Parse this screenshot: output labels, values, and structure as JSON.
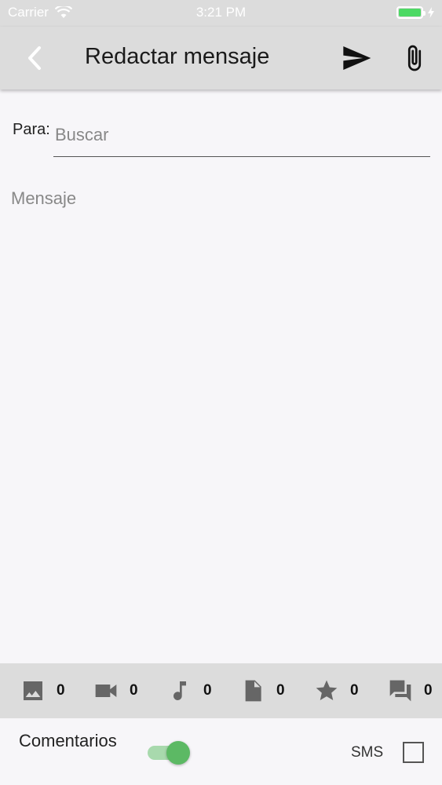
{
  "status_bar": {
    "carrier": "Carrier",
    "time": "3:21 PM",
    "wifi_icon": "wifi-icon",
    "battery_icon": "battery-icon",
    "charging_icon": "lightning-icon",
    "battery_color": "#4cd964"
  },
  "nav": {
    "title": "Redactar mensaje",
    "back_icon": "chevron-left-icon",
    "send_icon": "send-icon",
    "attach_icon": "paperclip-icon"
  },
  "to_field": {
    "label": "Para:",
    "placeholder": "Buscar",
    "value": ""
  },
  "message": {
    "placeholder": "Mensaje",
    "value": ""
  },
  "attachments": [
    {
      "icon": "image-icon",
      "count": "0"
    },
    {
      "icon": "video-icon",
      "count": "0"
    },
    {
      "icon": "music-note-icon",
      "count": "0"
    },
    {
      "icon": "document-icon",
      "count": "0"
    },
    {
      "icon": "star-icon",
      "count": "0"
    },
    {
      "icon": "chat-icon",
      "count": "0"
    }
  ],
  "bottom": {
    "comments_label": "Comentarios",
    "comments_enabled": true,
    "sms_label": "SMS",
    "sms_checked": false,
    "toggle_color": "#5cb964"
  }
}
